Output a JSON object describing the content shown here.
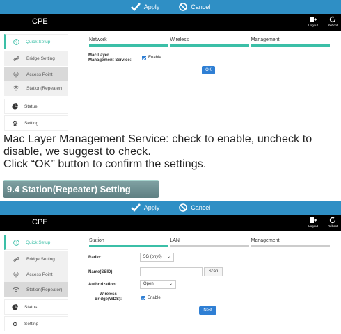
{
  "screen1": {
    "topbar": {
      "apply": "Apply",
      "cancel": "Cancel"
    },
    "header": {
      "title": "CPE",
      "logout": "Logout",
      "reboot": "Reboot"
    },
    "sidebar": {
      "quick_setup": "Quick Setup",
      "bridge_setting": "Bridge Setting",
      "access_point": "Access Point",
      "station_repeater": "Station(Repeater)",
      "status": "Statue",
      "setting": "Setting"
    },
    "tabs": [
      "Network",
      "Wireless",
      "Management"
    ],
    "form": {
      "mac_label": "Mac Layer\nManagement Service:",
      "enable": "Enable",
      "ok": "OK"
    }
  },
  "doc": {
    "para1": "Mac Layer Management Service: check to enable, uncheck to disable, we suggest to check.",
    "para2": "Click “OK” button to confirm the settings.",
    "section_title": "9.4 Station(Repeater) Setting"
  },
  "screen2": {
    "topbar": {
      "apply": "Apply",
      "cancel": "Cancel"
    },
    "header": {
      "title": "CPE",
      "logout": "Logout",
      "reboot": "Reboot"
    },
    "sidebar": {
      "quick_setup": "Quick Setup",
      "bridge_setting": "Bridge Setting",
      "access_point": "Access Point",
      "station_repeater": "Station(Repeater)",
      "status": "Status",
      "setting": "Setting"
    },
    "tabs": [
      "Station",
      "LAN",
      "Management"
    ],
    "form": {
      "radio_label": "Radio:",
      "radio_value": "5G (phy0)",
      "ssid_label": "Name(SSID):",
      "ssid_value": "",
      "scan": "Scan",
      "auth_label": "Authorization:",
      "auth_value": "Open",
      "wds_label": "Wireless\nBridge(WDS):",
      "enable": "Enable",
      "next": "Next"
    }
  },
  "colors": {
    "topbar": "#2f8fc5",
    "accent": "#3bbfa7",
    "button": "#2f7fd4"
  }
}
